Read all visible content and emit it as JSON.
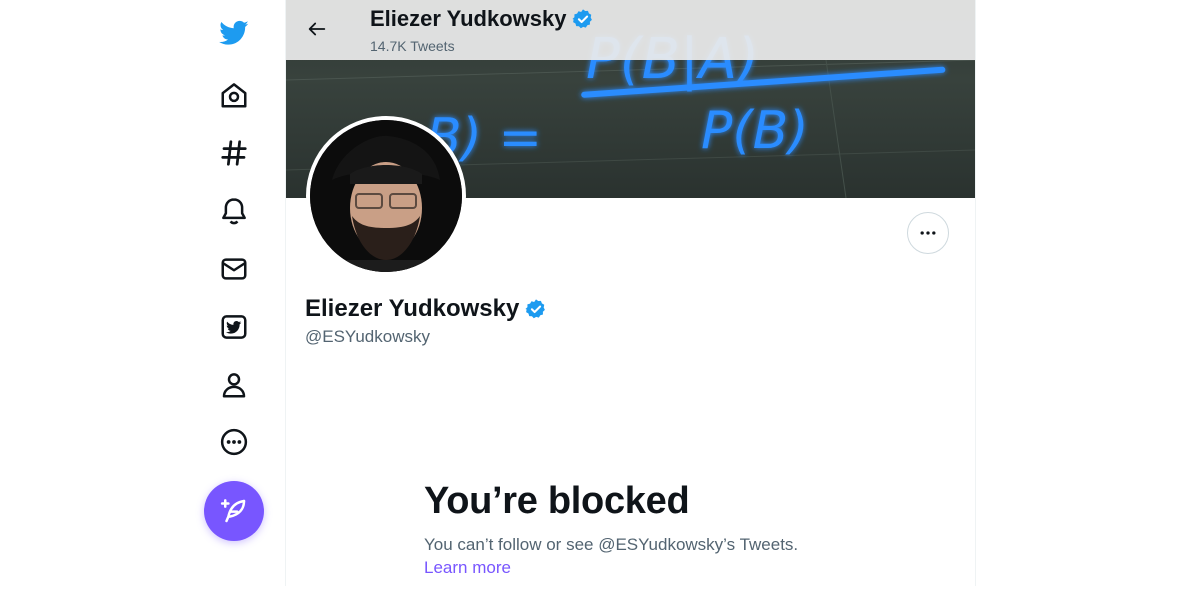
{
  "nav": {
    "items": [
      {
        "name": "twitter-logo",
        "icon": "twitter-bird-icon"
      },
      {
        "name": "home",
        "icon": "home-icon"
      },
      {
        "name": "explore",
        "icon": "hashtag-icon"
      },
      {
        "name": "notifications",
        "icon": "bell-icon"
      },
      {
        "name": "messages",
        "icon": "envelope-icon"
      },
      {
        "name": "twitter-blue",
        "icon": "twitter-blue-icon"
      },
      {
        "name": "profile",
        "icon": "person-icon"
      },
      {
        "name": "more",
        "icon": "more-circle-icon"
      }
    ],
    "compose_icon": "feather-plus-icon"
  },
  "header": {
    "name": "Eliezer Yudkowsky",
    "tweet_count": "14.7K Tweets"
  },
  "banner": {
    "formula_numerator": "P(B|A)",
    "formula_denominator": "P(B)",
    "formula_lhs_fragment": "B) ="
  },
  "profile": {
    "name": "Eliezer Yudkowsky",
    "handle": "@ESYudkowsky",
    "verified": true
  },
  "blocked": {
    "title": "You’re blocked",
    "message": "You can’t follow or see @ESYudkowsky’s Tweets.",
    "link": "Learn more"
  },
  "colors": {
    "accent": "#7856ff",
    "twitter_blue": "#1d9bf0",
    "text_primary": "#0f1419",
    "text_secondary": "#536471",
    "neon": "#2a8cff"
  }
}
